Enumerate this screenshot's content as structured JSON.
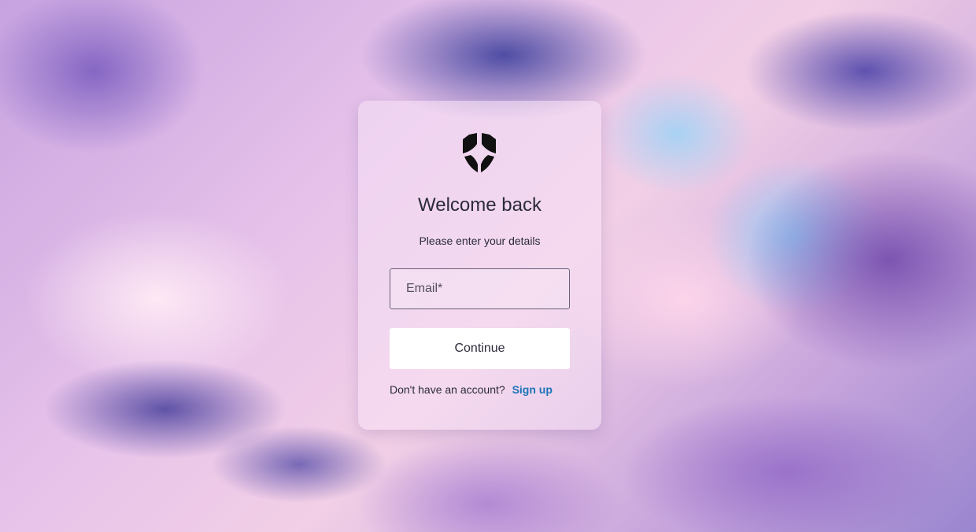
{
  "login": {
    "title": "Welcome back",
    "subtitle": "Please enter your details",
    "email_placeholder": "Email*",
    "email_value": "",
    "continue_label": "Continue",
    "signup_prompt": "Don't have an account?",
    "signup_label": "Sign up"
  },
  "icons": {
    "logo": "shield-logo-icon"
  },
  "colors": {
    "link": "#1b74b5",
    "text": "#2b2b3a",
    "button_bg": "#ffffff"
  }
}
